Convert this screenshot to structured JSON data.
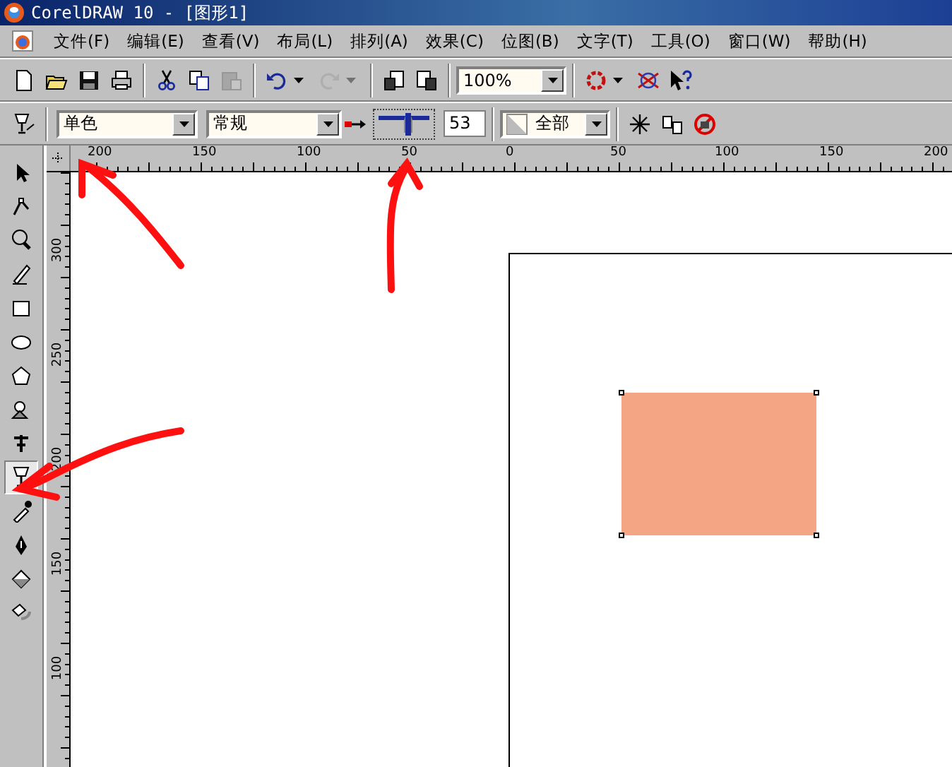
{
  "window": {
    "title": "CorelDRAW 10 - [图形1]"
  },
  "menu": [
    "文件(F)",
    "编辑(E)",
    "查看(V)",
    "布局(L)",
    "排列(A)",
    "效果(C)",
    "位图(B)",
    "文字(T)",
    "工具(O)",
    "窗口(W)",
    "帮助(H)"
  ],
  "standard_toolbar": {
    "buttons": [
      {
        "disabled": false
      },
      {
        "disabled": false
      },
      {
        "disabled": false
      },
      {
        "disabled": false
      },
      {
        "disabled": false
      },
      {
        "disabled": false
      },
      {
        "disabled": true
      },
      {
        "disabled": false
      },
      {
        "disabled": true
      },
      {
        "disabled": false
      },
      {
        "disabled": false
      }
    ],
    "zoom": "100%"
  },
  "property_bar": {
    "fill_type": "单色",
    "mode": "常规",
    "transparency": "53",
    "level": 0.53,
    "target": "全部",
    "frozen": false
  },
  "toolbox": [
    {
      "selected": false
    },
    {
      "selected": false
    },
    {
      "selected": false
    },
    {
      "selected": false
    },
    {
      "selected": false
    },
    {
      "selected": false
    },
    {
      "selected": false
    },
    {
      "selected": false
    },
    {
      "selected": false
    },
    {
      "selected": true
    },
    {
      "selected": false
    },
    {
      "selected": false
    },
    {
      "selected": false
    },
    {
      "selected": false
    }
  ],
  "horizontal_ruler": [
    "200",
    "150",
    "100",
    "50",
    "0",
    "50",
    "100",
    "150",
    "200"
  ],
  "vertical_ruler": [
    "300",
    "250",
    "200",
    "150",
    "100"
  ],
  "shape": {
    "color": "#f4a584",
    "selected": true
  }
}
